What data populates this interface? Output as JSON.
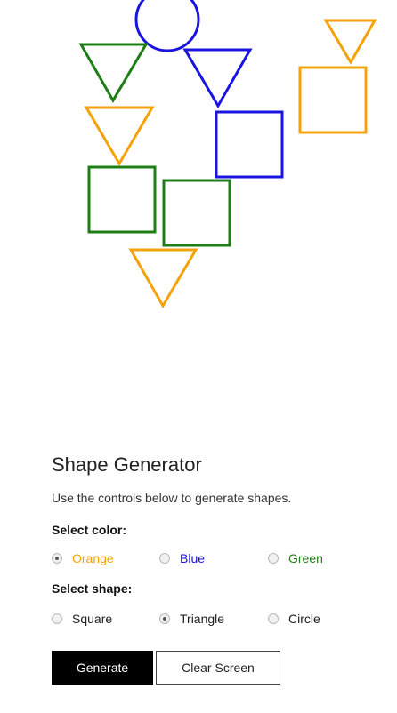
{
  "app": {
    "title": "Shape Generator",
    "description": "Use the controls below to generate shapes."
  },
  "color_section": {
    "label": "Select color:",
    "options": [
      {
        "label": "Orange",
        "color": "#f5a20a",
        "selected": true
      },
      {
        "label": "Blue",
        "color": "#1a14e0",
        "selected": false
      },
      {
        "label": "Green",
        "color": "#1e7d14",
        "selected": false
      }
    ]
  },
  "shape_section": {
    "label": "Select shape:",
    "options": [
      {
        "label": "Square",
        "selected": false
      },
      {
        "label": "Triangle",
        "selected": true
      },
      {
        "label": "Circle",
        "selected": false
      }
    ]
  },
  "buttons": {
    "generate": "Generate",
    "clear": "Clear Screen"
  },
  "shapes": [
    {
      "type": "circle",
      "color": "blue"
    },
    {
      "type": "triangle",
      "color": "orange"
    },
    {
      "type": "square",
      "color": "orange"
    },
    {
      "type": "triangle",
      "color": "green"
    },
    {
      "type": "triangle",
      "color": "blue"
    },
    {
      "type": "triangle",
      "color": "orange"
    },
    {
      "type": "square",
      "color": "blue"
    },
    {
      "type": "square",
      "color": "green"
    },
    {
      "type": "square",
      "color": "green"
    },
    {
      "type": "triangle",
      "color": "orange"
    }
  ],
  "palette": {
    "orange": "#f5a20a",
    "blue": "#1a14e0",
    "green": "#1e7d14"
  }
}
